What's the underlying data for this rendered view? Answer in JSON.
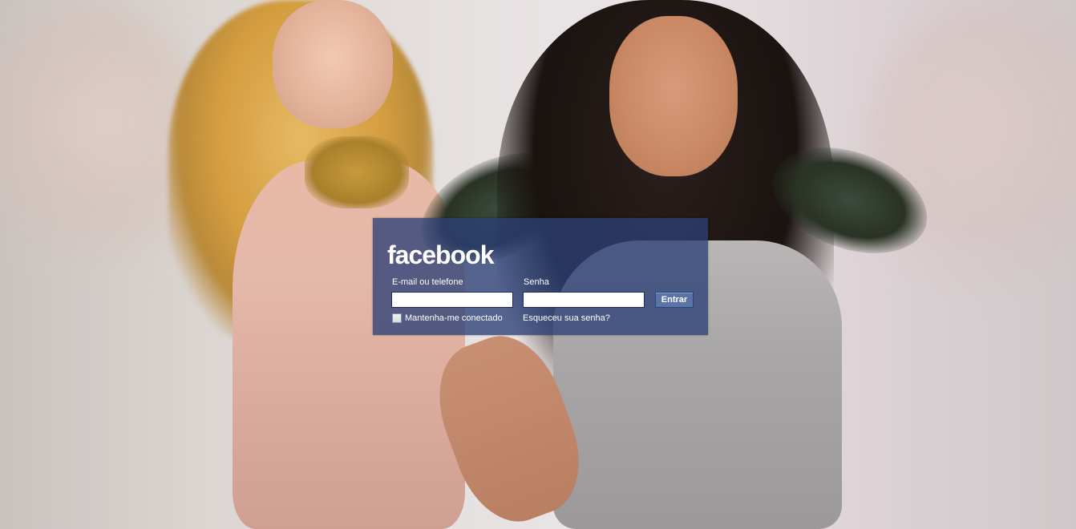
{
  "brand": {
    "logo_text": "facebook"
  },
  "login": {
    "email_label": "E-mail ou telefone",
    "email_value": "",
    "password_label": "Senha",
    "password_value": "",
    "submit_label": "Entrar",
    "remember_label": "Mantenha-me conectado",
    "remember_checked": false,
    "forgot_label": "Esqueceu sua senha?"
  },
  "colors": {
    "panel": "#2c4076",
    "button": "#5b74a8",
    "text": "#ffffff"
  }
}
